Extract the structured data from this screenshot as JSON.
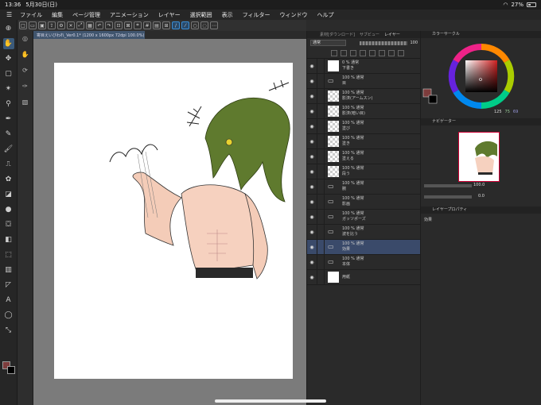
{
  "status": {
    "time": "13:36",
    "date": "5月30日(日)",
    "battery": "27%"
  },
  "menu": [
    "ファイル",
    "編集",
    "ページ管理",
    "アニメーション",
    "レイヤー",
    "選択範囲",
    "表示",
    "フィルター",
    "ウィンドウ",
    "ヘルプ"
  ],
  "document_tab": "寄目えいびわれ_Ver0.1* (1200 x 1600px 72dpi 100.0%)",
  "layer_panel": {
    "tabs": [
      "素材[ダウンロード]",
      "サブビュー",
      "レイヤー"
    ],
    "blend_mode": "通常",
    "opacity": "100",
    "layers": [
      {
        "pct": "0 %  通常",
        "name": "下書き",
        "thumb": "white",
        "kind": "layer"
      },
      {
        "pct": "100 %  通常",
        "name": "目",
        "thumb": "none",
        "kind": "folder"
      },
      {
        "pct": "100 %  通常",
        "name": "影済(アームスン)",
        "thumb": "check",
        "kind": "layer"
      },
      {
        "pct": "100 %  通常",
        "name": "影済(暗い目)",
        "thumb": "check",
        "kind": "layer"
      },
      {
        "pct": "100 %  通常",
        "name": "塗び",
        "thumb": "check",
        "kind": "layer"
      },
      {
        "pct": "100 %  通常",
        "name": "塗き",
        "thumb": "check",
        "kind": "layer"
      },
      {
        "pct": "100 %  通常",
        "name": "塗える",
        "thumb": "check",
        "kind": "layer"
      },
      {
        "pct": "100 %  通常",
        "name": "段う",
        "thumb": "check",
        "kind": "layer"
      },
      {
        "pct": "100 %  通常",
        "name": "腕",
        "thumb": "none",
        "kind": "folder"
      },
      {
        "pct": "100 %  通常",
        "name": "影画",
        "thumb": "none",
        "kind": "folder"
      },
      {
        "pct": "100 %  通常",
        "name": "ガッツポーズ",
        "thumb": "none",
        "kind": "folder"
      },
      {
        "pct": "100 %  通常",
        "name": "波を比う",
        "thumb": "none",
        "kind": "folder"
      },
      {
        "pct": "100 %  通常",
        "name": "効果",
        "thumb": "none",
        "kind": "folder",
        "selected": true
      },
      {
        "pct": "100 %  通常",
        "name": "本体",
        "thumb": "none",
        "kind": "folder"
      },
      {
        "pct": "",
        "name": "用紙",
        "thumb": "white",
        "kind": "paper"
      }
    ]
  },
  "right_panel": {
    "color_circle_title": "カラーサークル",
    "rgb": [
      "125",
      "75",
      "69"
    ],
    "navigator_title": "ナビゲーター",
    "zoom": "100.0",
    "rotation": "0.0",
    "layer_property_title": "レイヤープロパティ",
    "effect_label": "効果"
  },
  "colors": {
    "main": "#7d3c3c",
    "sub": "#000000",
    "accent": "#3a8fd8"
  }
}
